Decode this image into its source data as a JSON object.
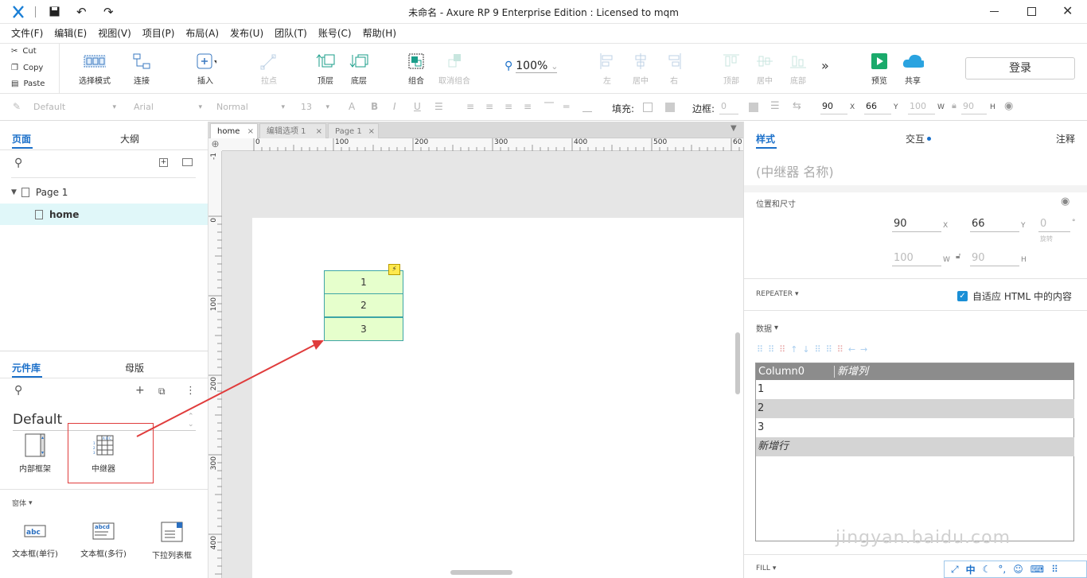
{
  "window": {
    "title": "未命名 - Axure RP 9 Enterprise Edition : Licensed to mqm"
  },
  "menu": [
    "文件(F)",
    "编辑(E)",
    "视图(V)",
    "项目(P)",
    "布局(A)",
    "发布(U)",
    "团队(T)",
    "账号(C)",
    "帮助(H)"
  ],
  "clipboard": {
    "cut": "Cut",
    "copy": "Copy",
    "paste": "Paste"
  },
  "toolbar": {
    "select": "选择模式",
    "connect": "连接",
    "insert": "插入",
    "point": "拉点",
    "front": "顶层",
    "back": "底层",
    "group": "组合",
    "ungroup": "取消组合",
    "zoom": "100%",
    "left": "左",
    "center": "居中",
    "right": "右",
    "top": "顶部",
    "middle": "居中",
    "bottom": "底部",
    "preview": "预览",
    "share": "共享",
    "login": "登录"
  },
  "format": {
    "style": "Default",
    "font": "Arial",
    "weight": "Normal",
    "size": "13",
    "fill": "填充:",
    "border": "边框:",
    "border_value": "0",
    "x": "90",
    "x_label": "X",
    "y": "66",
    "y_label": "Y",
    "w": "100",
    "w_label": "W",
    "h": "90",
    "h_label": "H"
  },
  "pages_panel": {
    "tab_pages": "页面",
    "tab_outline": "大纲",
    "page1": "Page 1",
    "home": "home"
  },
  "library_panel": {
    "tab_lib": "元件库",
    "tab_master": "母版",
    "library": "Default",
    "item_iframe": "内部框架",
    "item_repeater": "中继器",
    "section_form": "窗体",
    "item_textbox": "文本框(单行)",
    "item_textarea": "文本框(多行)",
    "item_dropdown": "下拉列表框",
    "section_arrow": "▾"
  },
  "doc_tabs": [
    "home",
    "编辑选项 1",
    "Page 1"
  ],
  "ruler": {
    "h": [
      "0",
      "100",
      "200",
      "300",
      "400",
      "500",
      "60"
    ],
    "v": [
      "-1",
      "0",
      "100",
      "200",
      "300",
      "400"
    ]
  },
  "repeater_rows": [
    "1",
    "2",
    "3"
  ],
  "inspector": {
    "tab_style": "样式",
    "tab_interact": "交互",
    "tab_notes": "注释",
    "name_placeholder": "(中继器 名称)",
    "pos_size": "位置和尺寸",
    "x": "90",
    "x_label": "X",
    "y": "66",
    "y_label": "Y",
    "rot": "0",
    "rot_unit": "°",
    "rot_label": "旋转",
    "w": "100",
    "w_label": "W",
    "h": "90",
    "h_label": "H",
    "repeater": "REPEATER",
    "fit_html": "自适应 HTML 中的内容",
    "data": "数据",
    "column0": "Column0",
    "add_col": "新增列",
    "rows": [
      "1",
      "2",
      "3"
    ],
    "add_row": "新增行",
    "fill": "FILL"
  },
  "ime": {
    "lang": "中"
  },
  "watermark": {
    "domain": "jingyan.baidu.com"
  }
}
